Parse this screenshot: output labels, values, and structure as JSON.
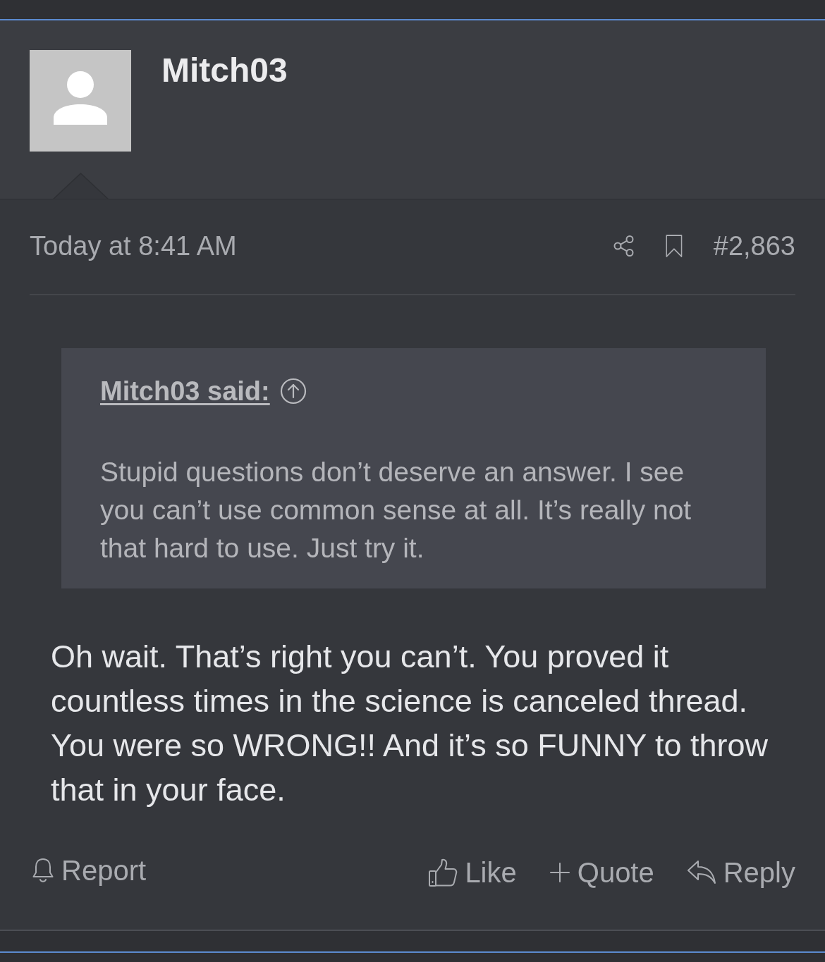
{
  "post": {
    "author": {
      "name": "Mitch03"
    },
    "date": "Today at 8:41 AM",
    "post_number": "#2,863",
    "quote": {
      "attribution": "Mitch03 said:",
      "text": "Stupid questions don’t deserve an answer. I see you can’t use common sense at all. It’s really not that hard to use. Just try it."
    },
    "body": "Oh wait. That’s right you can’t. You proved it countless times in the science is canceled thread. You were so WRONG!! And it’s so FUNNY to throw that in your face.",
    "footer_left": [
      {
        "kind": "report",
        "label": "Report"
      }
    ],
    "footer_right": [
      {
        "kind": "like",
        "label": "Like"
      },
      {
        "kind": "quote",
        "label": "Quote"
      },
      {
        "kind": "reply",
        "label": "Reply"
      }
    ]
  }
}
